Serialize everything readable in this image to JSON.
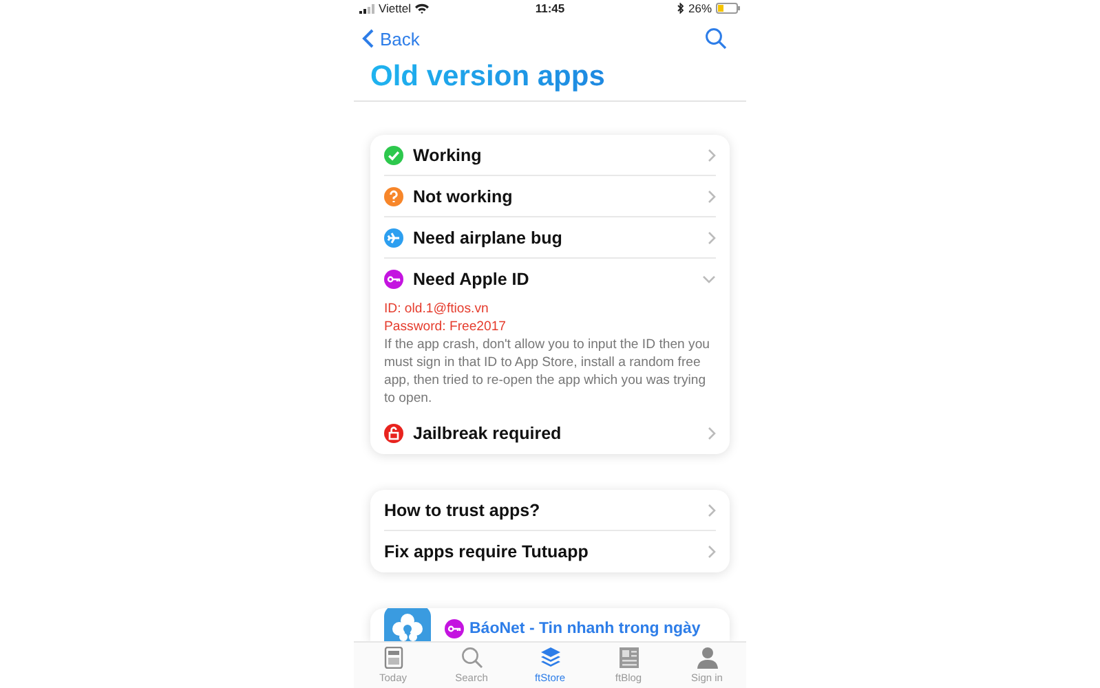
{
  "status_bar": {
    "carrier": "Viettel",
    "time": "11:45",
    "battery": "26%"
  },
  "nav": {
    "back": "Back"
  },
  "title": "Old version apps",
  "categories": [
    {
      "kind": "check",
      "label": "Working",
      "expanded": false
    },
    {
      "kind": "question",
      "label": "Not working",
      "expanded": false
    },
    {
      "kind": "plane",
      "label": "Need airplane bug",
      "expanded": false
    },
    {
      "kind": "key",
      "label": "Need Apple ID",
      "expanded": true,
      "details": {
        "id_line": "ID: old.1@ftios.vn",
        "password_line": "Password: Free2017",
        "note": "If the app crash, don't allow you to input the ID then you must sign in that ID to App Store, install a random free app, then tried to re-open the app which you was trying to open."
      }
    },
    {
      "kind": "lock",
      "label": "Jailbreak required",
      "expanded": false
    }
  ],
  "help_links": [
    "How to trust apps?",
    "Fix apps require Tutuapp"
  ],
  "app_card": {
    "title": "BáoNet - Tin nhanh trong ngày"
  },
  "tab_bar": [
    {
      "kind": "today",
      "label": "Today",
      "selected": false
    },
    {
      "kind": "search",
      "label": "Search",
      "selected": false
    },
    {
      "kind": "store",
      "label": "ftStore",
      "selected": true
    },
    {
      "kind": "blog",
      "label": "ftBlog",
      "selected": false
    },
    {
      "kind": "person",
      "label": "Sign in",
      "selected": false
    }
  ]
}
